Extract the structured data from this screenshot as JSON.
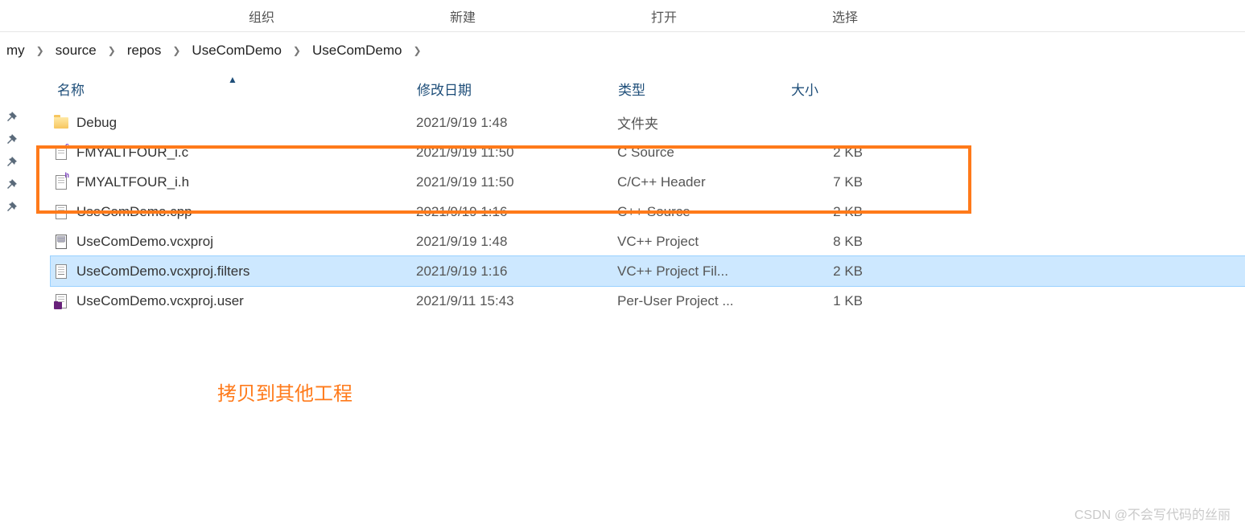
{
  "ribbon": {
    "groups": [
      "组织",
      "新建",
      "打开",
      "选择"
    ]
  },
  "breadcrumb": {
    "items": [
      "my",
      "source",
      "repos",
      "UseComDemo",
      "UseComDemo"
    ]
  },
  "columns": {
    "name": "名称",
    "modified": "修改日期",
    "type": "类型",
    "size": "大小"
  },
  "rows": [
    {
      "icon": "folder",
      "name": "Debug",
      "date": "2021/9/19 1:48",
      "type": "文件夹",
      "size": "",
      "selected": false
    },
    {
      "icon": "c-src",
      "name": "FMYALTFOUR_i.c",
      "date": "2021/9/19 11:50",
      "type": "C Source",
      "size": "2 KB",
      "selected": false
    },
    {
      "icon": "h-src",
      "name": "FMYALTFOUR_i.h",
      "date": "2021/9/19 11:50",
      "type": "C/C++ Header",
      "size": "7 KB",
      "selected": false
    },
    {
      "icon": "cpp-src",
      "name": "UseComDemo.cpp",
      "date": "2021/9/19 1:16",
      "type": "C++ Source",
      "size": "2 KB",
      "selected": false
    },
    {
      "icon": "proj",
      "name": "UseComDemo.vcxproj",
      "date": "2021/9/19 1:48",
      "type": "VC++ Project",
      "size": "8 KB",
      "selected": false
    },
    {
      "icon": "filters",
      "name": "UseComDemo.vcxproj.filters",
      "date": "2021/9/19 1:16",
      "type": "VC++ Project Fil...",
      "size": "2 KB",
      "selected": true
    },
    {
      "icon": "user",
      "name": "UseComDemo.vcxproj.user",
      "date": "2021/9/11 15:43",
      "type": "Per-User Project ...",
      "size": "1 KB",
      "selected": false
    }
  ],
  "annotation": "拷贝到其他工程",
  "watermark": "CSDN @不会写代码的丝丽"
}
